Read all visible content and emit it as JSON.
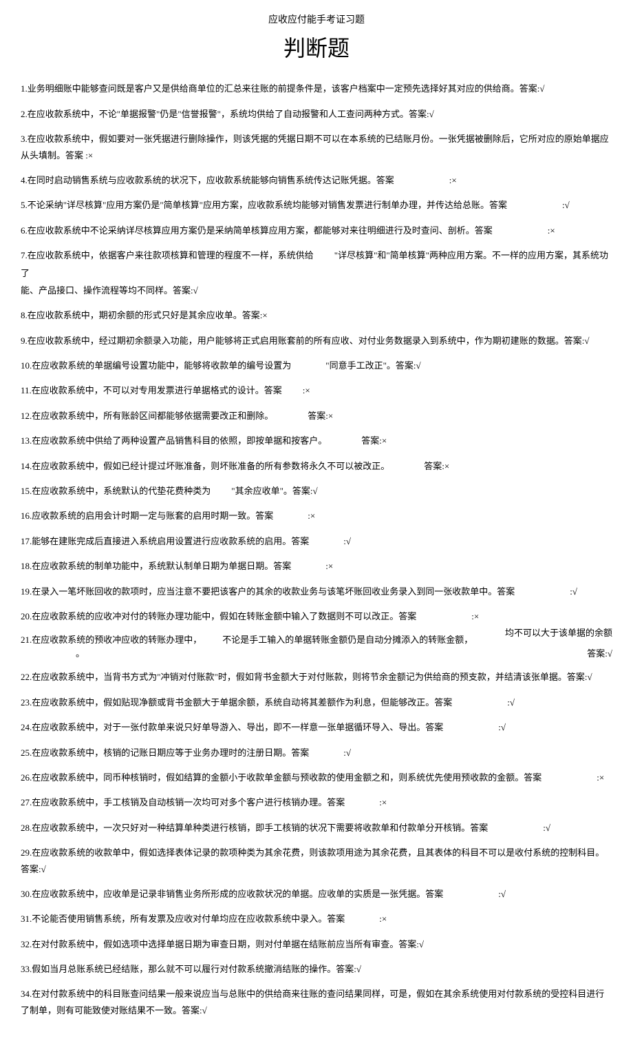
{
  "subtitle": "应收应付能手考证习题",
  "main_title": "判断题",
  "answer_label": "答案:",
  "answer_label_alt": "答案",
  "answer_label_spaced": "答案      :",
  "true_mark": "√",
  "false_mark": "×",
  "questions": {
    "q1": "1.业务明细账中能够查问既是客户又是供给商单位的汇总来往账的前提条件是，该客户档案中一定预先选择好其对应的供给商。答案:√",
    "q2": "2.在应收款系统中，不论\"单据报警\"仍是\"信誉报警\"，系统均供给了自动报警和人工查问两种方式。答案:√",
    "q3": "3.在应收款系统中，假如要对一张凭据进行删除操作，则该凭据的凭据日期不可以在本系统的已结账月份。一张凭据被删除后，它所对应的原始单据应从头填制。答案      :×",
    "q4": "4.在同时启动销售系统与应收款系统的状况下，应收款系统能够向销售系统传达记账凭据。答案",
    "q4_ans": ":×",
    "q5": "5.不论采纳\"详尽核算\"应用方案仍是\"简单核算\"应用方案，应收款系统均能够对销售发票进行制单办理，并传达给总账。答案",
    "q5_ans": ":√",
    "q6": "6.在应收款系统中不论采纳详尽核算应用方案仍是采纳简单核算应用方案，都能够对来往明细进行及时查问、剖析。答案",
    "q6_ans": ":×",
    "q7_a": "7.在应收款系统中，依据客户来往款项核算和管理的程度不一样，系统供给",
    "q7_b": "\"详尽核算\"和\"简单核算\"两种应用方案。不一样的应用方案，其系统功",
    "q7_c": "了",
    "q7_d": "能、产品接口、操作流程等均不同样。答案:√",
    "q8": "8.在应收款系统中，期初余额的形式只好是其余应收单。答案:×",
    "q9": "9.在应收款系统中，经过期初余额录入功能，用户能够将正式启用账套前的所有应收、对付业务数据录入到系统中，作为期初建账的数据。答案:√",
    "q10_a": "10.在应收款系统的单据编号设置功能中，能够将收款单的编号设置为",
    "q10_b": "\"同意手工改正\"。答案:√",
    "q11": "11.在应收款系统中，不可以对专用发票进行单据格式的设计。答案",
    "q11_ans": ":×",
    "q12": "12.在应收款系统中，所有账龄区间都能够依据需要改正和删除。",
    "q12_ans": "答案:×",
    "q13": "13.在应收款系统中供给了两种设置产品销售科目的依照，即按单据和按客户。",
    "q13_ans": "答案:×",
    "q14": "14.在应收款系统中，假如已经计提过坏账准备，则坏账准备的所有参数将永久不可以被改正。",
    "q14_ans": "答案:×",
    "q15_a": "15.在应收款系统中，系统默认的代垫花费种类为",
    "q15_b": "\"其余应收单\"。答案:√",
    "q16": "16.应收款系统的启用会计时期一定与账套的启用时期一致。答案",
    "q16_ans": ":×",
    "q17": "17.能够在建账完成后直接进入系统启用设置进行应收款系统的启用。答案",
    "q17_ans": ":√",
    "q18": "18.在应收款系统的制单功能中，系统默认制单日期为单据日期。答案",
    "q18_ans": ":×",
    "q19": "19.在录入一笔坏账回收的款项时，应当注意不要把该客户的其余的收款业务与该笔坏账回收业务录入到同一张收款单中。答案",
    "q19_ans": ":√",
    "q20": "20.在应收款系统的应收冲对付的转账办理功能中，假如在转账金额中输入了数据则不可以改正。答案",
    "q20_ans": ":×",
    "q21_a": "21.在应收款系统的预收冲应收的转账办理中，",
    "q21_b": "不论是手工输入的单据转账金额仍是自动分摊添入的转账金额，",
    "q21_c": "均不可以大于该单据的余额",
    "q21_d": "。",
    "q21_ans": "答案:√",
    "q22": "22.在应收款系统中，当背书方式为\"冲销对付账款\"时，假如背书金额大于对付账款，则将节余金额记为供给商的预支款，并结清该张单据。答案:√",
    "q23": "23.在应收款系统中，假如贴现净额或背书金额大于单据余额，系统自动将其差额作为利息，但能够改正。答案",
    "q23_ans": ":√",
    "q24": "24.在应收款系统中，对于一张付款单来说只好单导游入、导出，即不一样意一张单据循环导入、导出。答案",
    "q24_ans": ":√",
    "q25": "25.在应收款系统中，核销的记账日期应等于业务办理时的注册日期。答案",
    "q25_ans": ":√",
    "q26": "26.在应收款系统中，同币种核销时，假如结算的金额小于收款单金额与预收款的使用金额之和，则系统优先使用预收款的金额。答案",
    "q26_ans": ":×",
    "q27": "27.在应收款系统中，手工核销及自动核销一次均可对多个客户进行核销办理。答案",
    "q27_ans": ":×",
    "q28": "28.在应收款系统中，一次只好对一种结算单种类进行核销，即手工核销的状况下需要将收款单和付款单分开核销。答案",
    "q28_ans": ":√",
    "q29": "29.在应收款系统的收款单中，假如选择表体记录的款项种类为其余花费，则该款项用途为其余花费，且其表体的科目不可以是收付系统的控制科目。答案:√",
    "q30": "30.在应收款系统中，应收单是记录非销售业务所形成的应收款状况的单据。应收单的实质是一张凭据。答案",
    "q30_ans": ":√",
    "q31": "31.不论能否使用销售系统，所有发票及应收对付单均应在应收款系统中录入。答案",
    "q31_ans": ":×",
    "q32": "32.在对付款系统中，假如选项中选择单据日期为审查日期，则对付单据在结账前应当所有审查。答案:√",
    "q33": "33.假如当月总账系统已经结账，那么就不可以履行对付款系统撤消结账的操作。答案:√",
    "q34": "34.在对付款系统中的科目账查问结果一般来说应当与总账中的供给商来往账的查问结果同样，可是，假如在其余系统使用对付款系统的受控科目进行了制单，则有可能致使对账结果不一致。答案:√"
  }
}
